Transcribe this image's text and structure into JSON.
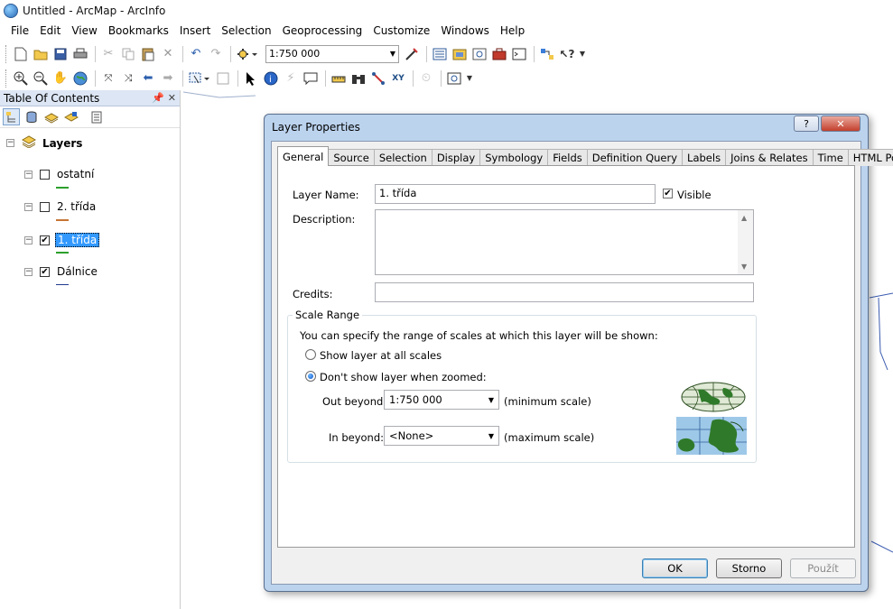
{
  "window": {
    "title": "Untitled - ArcMap - ArcInfo"
  },
  "menu": [
    "File",
    "Edit",
    "View",
    "Bookmarks",
    "Insert",
    "Selection",
    "Geoprocessing",
    "Customize",
    "Windows",
    "Help"
  ],
  "toolbar": {
    "scale_value": "1:750 000"
  },
  "toc": {
    "header": "Table Of Contents",
    "root": "Layers",
    "layers": [
      {
        "label": "ostatní",
        "checked": false,
        "color": "#2ca02c"
      },
      {
        "label": "2. třída",
        "checked": false,
        "color": "#c87533"
      },
      {
        "label": "1. třída",
        "checked": true,
        "color": "#2ca02c",
        "selected": true
      },
      {
        "label": "Dálnice",
        "checked": true,
        "color": "#1f3b8c"
      }
    ]
  },
  "dialog": {
    "title": "Layer Properties",
    "help_label": "?",
    "close_label": "✕",
    "tabs": [
      "General",
      "Source",
      "Selection",
      "Display",
      "Symbology",
      "Fields",
      "Definition Query",
      "Labels",
      "Joins & Relates",
      "Time",
      "HTML Popup"
    ],
    "active_tab": "General",
    "general": {
      "layer_name_label": "Layer Name:",
      "layer_name_value": "1. třída",
      "visible_label": "Visible",
      "visible_checked": true,
      "description_label": "Description:",
      "description_value": "",
      "credits_label": "Credits:",
      "credits_value": "",
      "scale_range": {
        "title": "Scale Range",
        "intro": "You can specify the range of scales at which this layer will be shown:",
        "option_all": "Show layer at all scales",
        "option_zoomed": "Don't show layer when zoomed:",
        "selected_option": "zoomed",
        "out_beyond_label": "Out beyond:",
        "out_beyond_value": "1:750 000",
        "out_beyond_note": "(minimum scale)",
        "in_beyond_label": "In beyond:",
        "in_beyond_value": "<None>",
        "in_beyond_note": "(maximum scale)"
      }
    },
    "buttons": {
      "ok": "OK",
      "cancel": "Storno",
      "apply": "Použít"
    }
  },
  "colors": {
    "selection": "#3399ff",
    "dialog_frame": "#bcd3ee",
    "toc_header": "#dce6f4"
  }
}
